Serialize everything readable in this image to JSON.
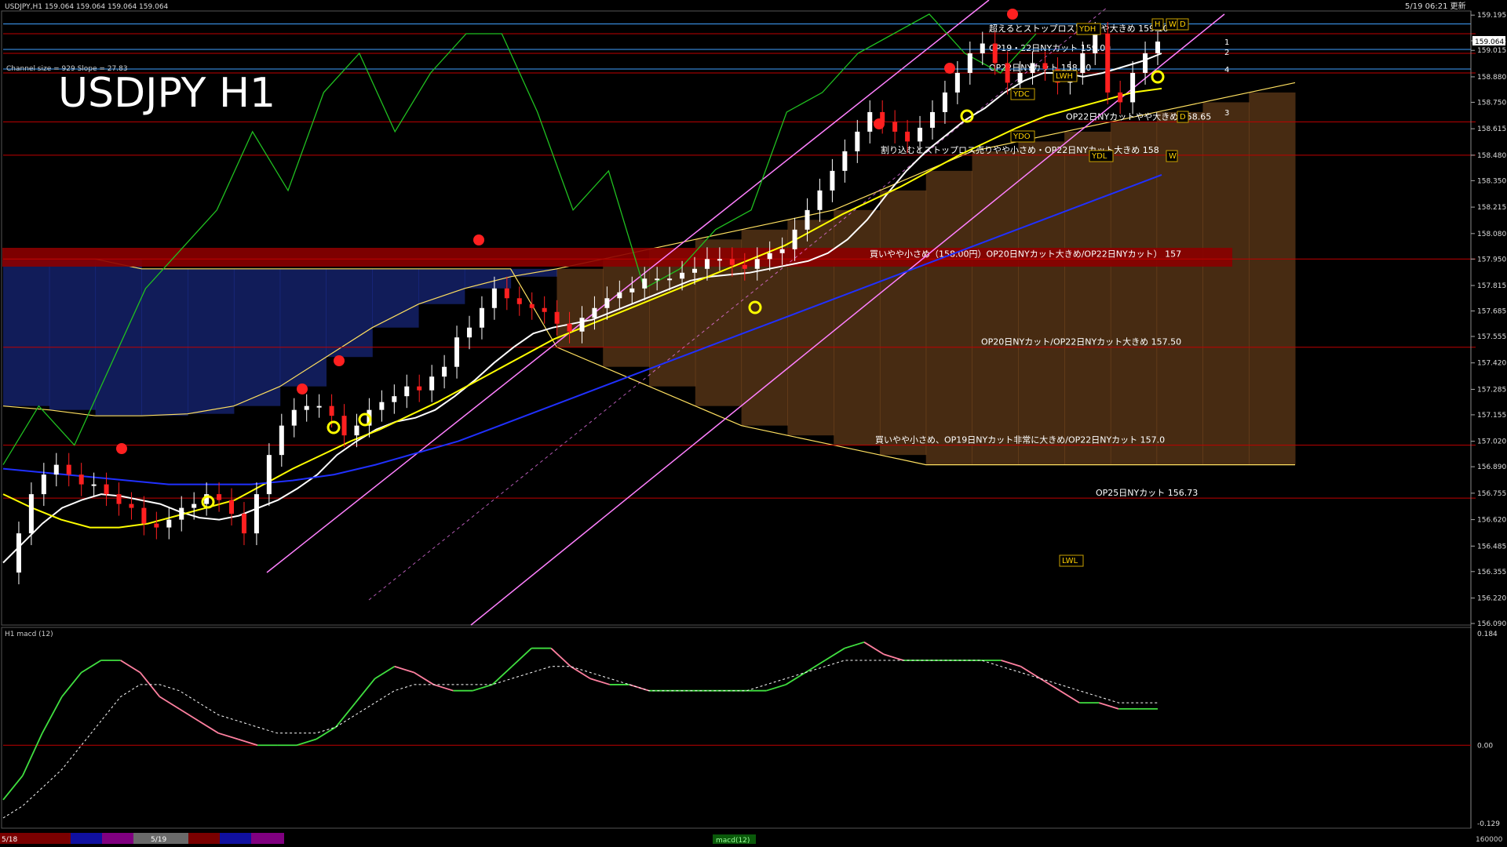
{
  "header": {
    "symbol_info": "USDJPY,H1  159.064 159.064 159.064 159.064",
    "datetime": "5/19 06:21 更新"
  },
  "main_panel": {
    "title": "USDJPY H1",
    "channel_info": "Channel size = 929 Slope = 27.83"
  },
  "sub_panel": {
    "label": "H1  macd (12)",
    "macd_tag": "macd(12)"
  },
  "colors": {
    "background": "#000000",
    "candle_up": "#ffffff",
    "candle_down": "#ff2020",
    "ema_fast": "#ffffff",
    "ema_mid": "#ffff00",
    "ema_slow": "#2030ff",
    "chikou": "#20c020",
    "channel": "#ff80ff",
    "cloud_bull": "#ff9a40",
    "cloud_bear": "#3050ff",
    "level_line": "#c00000",
    "band_fill": "#8b0000",
    "macd_up": "#40e040",
    "macd_down": "#ff80a0",
    "signal": "#ffffff",
    "cyan_level": "#40a0ff"
  },
  "chart_data": [
    {
      "type": "candlestick",
      "title": "USDJPY H1",
      "timeframe": "H1",
      "price_axis_ticks": [
        "159.195",
        "159.064",
        "159.015",
        "158.880",
        "158.750",
        "158.615",
        "158.480",
        "158.350",
        "158.215",
        "158.080",
        "157.950",
        "157.815",
        "157.685",
        "157.555",
        "157.420",
        "157.285",
        "157.155",
        "157.020",
        "156.890",
        "156.755",
        "156.620",
        "156.485",
        "156.355",
        "156.220",
        "156.090"
      ],
      "current_price": "159.064",
      "ylim": [
        156.09,
        159.2
      ],
      "date_labels": [
        "5/18",
        "5/19"
      ],
      "close_series": [
        156.35,
        156.55,
        156.75,
        156.85,
        156.9,
        156.85,
        156.8,
        156.8,
        156.75,
        156.7,
        156.68,
        156.6,
        156.58,
        156.62,
        156.68,
        156.7,
        156.75,
        156.72,
        156.65,
        156.55,
        156.75,
        156.95,
        157.1,
        157.18,
        157.2,
        157.2,
        157.15,
        157.05,
        157.1,
        157.18,
        157.22,
        157.25,
        157.3,
        157.28,
        157.35,
        157.4,
        157.55,
        157.6,
        157.7,
        157.8,
        157.75,
        157.72,
        157.7,
        157.68,
        157.62,
        157.58,
        157.65,
        157.7,
        157.75,
        157.78,
        157.8,
        157.85,
        157.85,
        157.85,
        157.88,
        157.9,
        157.95,
        157.95,
        157.92,
        157.9,
        157.95,
        157.98,
        158.0,
        158.1,
        158.2,
        158.3,
        158.4,
        158.5,
        158.6,
        158.7,
        158.65,
        158.6,
        158.55,
        158.62,
        158.7,
        158.8,
        158.9,
        159.0,
        159.05,
        158.95,
        158.85,
        158.9,
        158.95,
        158.92,
        158.85,
        158.9,
        159.0,
        159.1,
        158.8,
        158.75,
        158.9,
        159.0,
        159.06
      ],
      "moving_averages": [
        {
          "color": "#ffffff",
          "values": [
            156.4,
            156.5,
            156.6,
            156.68,
            156.72,
            156.75,
            156.74,
            156.72,
            156.7,
            156.66,
            156.63,
            156.62,
            156.64,
            156.68,
            156.72,
            156.78,
            156.85,
            156.95,
            157.02,
            157.08,
            157.12,
            157.14,
            157.18,
            157.25,
            157.33,
            157.42,
            157.5,
            157.57,
            157.6,
            157.62,
            157.64,
            157.68,
            157.72,
            157.76,
            157.8,
            157.84,
            157.86,
            157.87,
            157.88,
            157.9,
            157.92,
            157.94,
            157.98,
            158.05,
            158.15,
            158.28,
            158.4,
            158.5,
            158.58,
            158.66,
            158.72,
            158.8,
            158.86,
            158.9,
            158.9,
            158.88,
            158.9,
            158.93,
            158.96,
            159.0
          ]
        },
        {
          "color": "#ffff00",
          "values": [
            156.75,
            156.68,
            156.62,
            156.58,
            156.58,
            156.6,
            156.64,
            156.68,
            156.72,
            156.8,
            156.88,
            156.95,
            157.02,
            157.08,
            157.15,
            157.22,
            157.3,
            157.38,
            157.46,
            157.54,
            157.6,
            157.66,
            157.72,
            157.78,
            157.84,
            157.9,
            157.96,
            158.02,
            158.1,
            158.18,
            158.25,
            158.32,
            158.4,
            158.48,
            158.55,
            158.62,
            158.68,
            158.72,
            158.76,
            158.8,
            158.82
          ]
        },
        {
          "color": "#2030ff",
          "values": [
            156.88,
            156.86,
            156.84,
            156.82,
            156.8,
            156.8,
            156.8,
            156.82,
            156.85,
            156.9,
            156.96,
            157.02,
            157.1,
            157.18,
            157.26,
            157.34,
            157.42,
            157.5,
            157.58,
            157.66,
            157.74,
            157.82,
            157.9,
            157.98,
            158.06,
            158.14,
            158.22,
            158.3,
            158.38
          ]
        }
      ],
      "chikou_span": {
        "color": "#20c020",
        "values": [
          156.9,
          157.2,
          157.0,
          157.4,
          157.8,
          158.0,
          158.2,
          158.6,
          158.3,
          158.8,
          159.0,
          158.6,
          158.9,
          159.1,
          159.1,
          158.7,
          158.2,
          158.4,
          157.8,
          157.9,
          158.1,
          158.2,
          158.7,
          158.8,
          159.0,
          159.1,
          159.2,
          159.0,
          158.9,
          159.1
        ]
      },
      "ichimoku_cloud": {
        "span_a": [
          157.2,
          157.18,
          157.15,
          157.15,
          157.16,
          157.2,
          157.3,
          157.45,
          157.6,
          157.72,
          157.8,
          157.86,
          157.9,
          157.95,
          158.0,
          158.05,
          158.1,
          158.15,
          158.2,
          158.3,
          158.4,
          158.5,
          158.55,
          158.6,
          158.65,
          158.7,
          158.75,
          158.8,
          158.85
        ],
        "span_b": [
          157.95,
          157.95,
          157.95,
          157.9,
          157.9,
          157.9,
          157.9,
          157.9,
          157.9,
          157.9,
          157.9,
          157.9,
          157.5,
          157.4,
          157.3,
          157.2,
          157.1,
          157.05,
          157.0,
          156.95,
          156.9,
          156.9,
          156.9,
          156.9,
          156.9,
          156.9,
          156.9,
          156.9,
          156.9
        ]
      },
      "channel": {
        "color": "#ff80ff",
        "upper": [
          [
            156.5,
            0
          ],
          [
            159.5,
            0
          ]
        ],
        "note": "parallel regression channel"
      },
      "levels": [
        {
          "price": 159.1,
          "label": "超えるとストップロス買いやや大きめ 159.10",
          "color": "#c00000"
        },
        {
          "price": 159.0,
          "label": "OP19・22日NYカット 159.00",
          "color": "#c00000"
        },
        {
          "price": 158.9,
          "label": "OP22日NYカット 158.90",
          "color": "#c00000"
        },
        {
          "price": 158.65,
          "label": "OP22日NYカットやや大きめ 158.65",
          "color": "#c00000"
        },
        {
          "price": 158.48,
          "label": "割り込むとストップロス売りやや小さめ・OP22日NYカット大きめ 158",
          "color": "#c00000"
        },
        {
          "price": 157.95,
          "label": "買いやや小さめ（158.00円）OP20日NYカット大きめ/OP22日NYカット） 157",
          "color": "#c00000"
        },
        {
          "price": 157.5,
          "label": "OP20日NYカット/OP22日NYカット大きめ 157.50",
          "color": "#c00000"
        },
        {
          "price": 157.0,
          "label": "買いやや小さめ、OP19日NYカット非常に大きめ/OP22日NYカット 157.0",
          "color": "#c00000"
        },
        {
          "price": 156.73,
          "label": "OP25日NYカット 156.73",
          "color": "#c00000"
        }
      ],
      "level_tags": [
        "YDH",
        "YDC",
        "YDO",
        "YDL",
        "LWH",
        "LWL",
        "H",
        "W",
        "D",
        "W",
        "D"
      ],
      "pivot_numbers": [
        "1",
        "2",
        "3",
        "4"
      ]
    },
    {
      "type": "line",
      "title": "H1  macd (12)",
      "ylim": [
        -0.129,
        0.184
      ],
      "y_ticks": [
        "0.184",
        "0.00",
        "-0.129"
      ],
      "zero_line": 0,
      "series": [
        {
          "values": [
            -0.09,
            -0.05,
            0.02,
            0.08,
            0.12,
            0.14,
            0.14,
            0.12,
            0.08,
            0.06,
            0.04,
            0.02,
            0.01,
            0.0,
            0.0,
            0.0,
            0.01,
            0.03,
            0.07,
            0.11,
            0.13,
            0.12,
            0.1,
            0.09,
            0.09,
            0.1,
            0.13,
            0.16,
            0.16,
            0.13,
            0.11,
            0.1,
            0.1,
            0.09,
            0.09,
            0.09,
            0.09,
            0.09,
            0.09,
            0.09,
            0.1,
            0.12,
            0.14,
            0.16,
            0.17,
            0.15,
            0.14,
            0.14,
            0.14,
            0.14,
            0.14,
            0.14,
            0.13,
            0.11,
            0.09,
            0.07,
            0.07,
            0.06,
            0.06,
            0.06
          ]
        },
        {
          "values": [
            -0.12,
            -0.1,
            -0.07,
            -0.04,
            0.0,
            0.04,
            0.08,
            0.1,
            0.1,
            0.09,
            0.07,
            0.05,
            0.04,
            0.03,
            0.02,
            0.02,
            0.02,
            0.03,
            0.05,
            0.07,
            0.09,
            0.1,
            0.1,
            0.1,
            0.1,
            0.1,
            0.11,
            0.12,
            0.13,
            0.13,
            0.12,
            0.11,
            0.1,
            0.09,
            0.09,
            0.09,
            0.09,
            0.09,
            0.09,
            0.1,
            0.11,
            0.12,
            0.13,
            0.14,
            0.14,
            0.14,
            0.14,
            0.14,
            0.14,
            0.14,
            0.14,
            0.13,
            0.12,
            0.11,
            0.1,
            0.09,
            0.08,
            0.07,
            0.07,
            0.07
          ]
        }
      ]
    }
  ],
  "bottom_bar": {
    "date_tags": [
      "5/18",
      "5/19"
    ],
    "right_value": "160000"
  }
}
